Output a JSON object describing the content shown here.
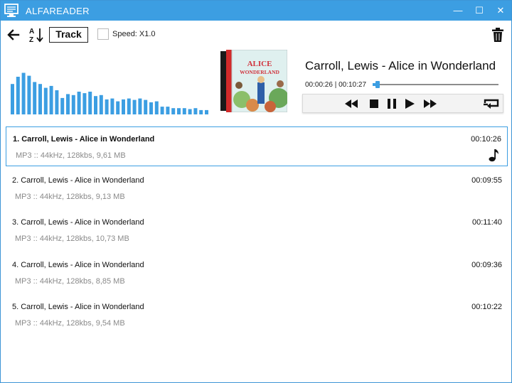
{
  "window": {
    "title": "ALFAREADER",
    "controls": {
      "minimize": "—",
      "maximize": "☐",
      "close": "✕"
    },
    "accent_color": "#3c9ee2"
  },
  "toolbar": {
    "back_icon": "arrow-left-icon",
    "sort_icon": "sort-a-z-icon",
    "track_label": "Track",
    "speed_checked": false,
    "speed_label": "Speed: X1.0",
    "delete_icon": "trash-icon"
  },
  "spectrum": {
    "color": "#3c9ee2",
    "levels": [
      0.63,
      0.78,
      0.86,
      0.8,
      0.67,
      0.63,
      0.55,
      0.59,
      0.5,
      0.34,
      0.42,
      0.4,
      0.47,
      0.44,
      0.47,
      0.38,
      0.4,
      0.31,
      0.33,
      0.27,
      0.31,
      0.33,
      0.3,
      0.33,
      0.3,
      0.25,
      0.27,
      0.16,
      0.16,
      0.13,
      0.13,
      0.13,
      0.11,
      0.13,
      0.09,
      0.09
    ]
  },
  "cover": {
    "title_line1": "ALICE",
    "title_line2": "WONDERLAND"
  },
  "now_playing": {
    "title": "Carroll, Lewis - Alice in Wonderland",
    "position": "00:00:26",
    "duration": "00:10:27",
    "time_readout": "00:00:26 | 00:10:27",
    "progress_fraction": 0.041
  },
  "transport": {
    "rewind_icon": "rewind-icon",
    "stop_icon": "stop-icon",
    "pause_icon": "pause-icon",
    "play_icon": "play-icon",
    "forward_icon": "fast-forward-icon",
    "repeat_icon": "repeat-icon"
  },
  "playlist": [
    {
      "title": "1. Carroll, Lewis - Alice in Wonderland",
      "info": "MP3 :: 44kHz, 128kbs, 9,61 MB",
      "duration": "00:10:26",
      "active": true,
      "icon": "music-note-icon"
    },
    {
      "title": "2. Carroll, Lewis - Alice in Wonderland",
      "info": "MP3 :: 44kHz, 128kbs, 9,13 MB",
      "duration": "00:09:55",
      "active": false
    },
    {
      "title": "3. Carroll, Lewis - Alice in Wonderland",
      "info": "MP3 :: 44kHz, 128kbs, 10,73 MB",
      "duration": "00:11:40",
      "active": false
    },
    {
      "title": "4. Carroll, Lewis - Alice in Wonderland",
      "info": "MP3 :: 44kHz, 128kbs, 8,85 MB",
      "duration": "00:09:36",
      "active": false
    },
    {
      "title": "5. Carroll, Lewis - Alice in Wonderland",
      "info": "MP3 :: 44kHz, 128kbs, 9,54 MB",
      "duration": "00:10:22",
      "active": false
    }
  ]
}
